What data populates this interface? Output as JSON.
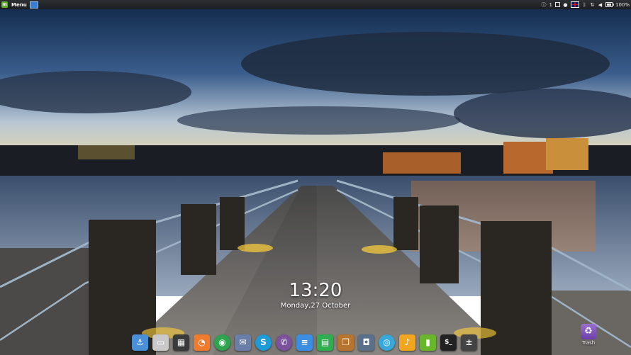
{
  "panel": {
    "menu_label": "Menu",
    "battery_percent": "100%",
    "notification_count": "1",
    "tray_icons": [
      "info-icon",
      "desktop-icon",
      "user-icon",
      "flag-uk-icon",
      "bluetooth-icon",
      "network-icon",
      "volume-icon",
      "battery-icon"
    ]
  },
  "clock": {
    "time": "13:20",
    "date": "Monday,27 October"
  },
  "dock": {
    "apps": [
      {
        "icon": "anchor-icon",
        "color": "#4a90d9"
      },
      {
        "icon": "folder-icon",
        "color": "#c9c9c9"
      },
      {
        "icon": "window-manager-icon",
        "color": "#3a3a3a"
      },
      {
        "icon": "swirl-icon",
        "color": "#f07a2e"
      },
      {
        "icon": "chrome-icon",
        "color": "#2ea44f"
      },
      {
        "icon": "mail-icon",
        "color": "#6a7fa8"
      },
      {
        "icon": "skype-icon",
        "color": "#1e9ad6"
      },
      {
        "icon": "viber-icon",
        "color": "#7b519d"
      },
      {
        "icon": "document-icon",
        "color": "#3d8ee0"
      },
      {
        "icon": "spreadsheet-icon",
        "color": "#2eae4f"
      },
      {
        "icon": "book-icon",
        "color": "#b7742f"
      },
      {
        "icon": "camera-icon",
        "color": "#5a6f8a"
      },
      {
        "icon": "wifi-hotspot-icon",
        "color": "#37a8d8"
      },
      {
        "icon": "music-icon",
        "color": "#f2a51f"
      },
      {
        "icon": "cup-icon",
        "color": "#69b52b"
      },
      {
        "icon": "terminal-icon",
        "color": "#222222"
      },
      {
        "icon": "calculator-icon",
        "color": "#444444"
      }
    ]
  },
  "desktop": {
    "trash_label": "Trash"
  },
  "colors": {
    "panel_bg": "#1c1e21",
    "accent": "#5fb12d"
  }
}
